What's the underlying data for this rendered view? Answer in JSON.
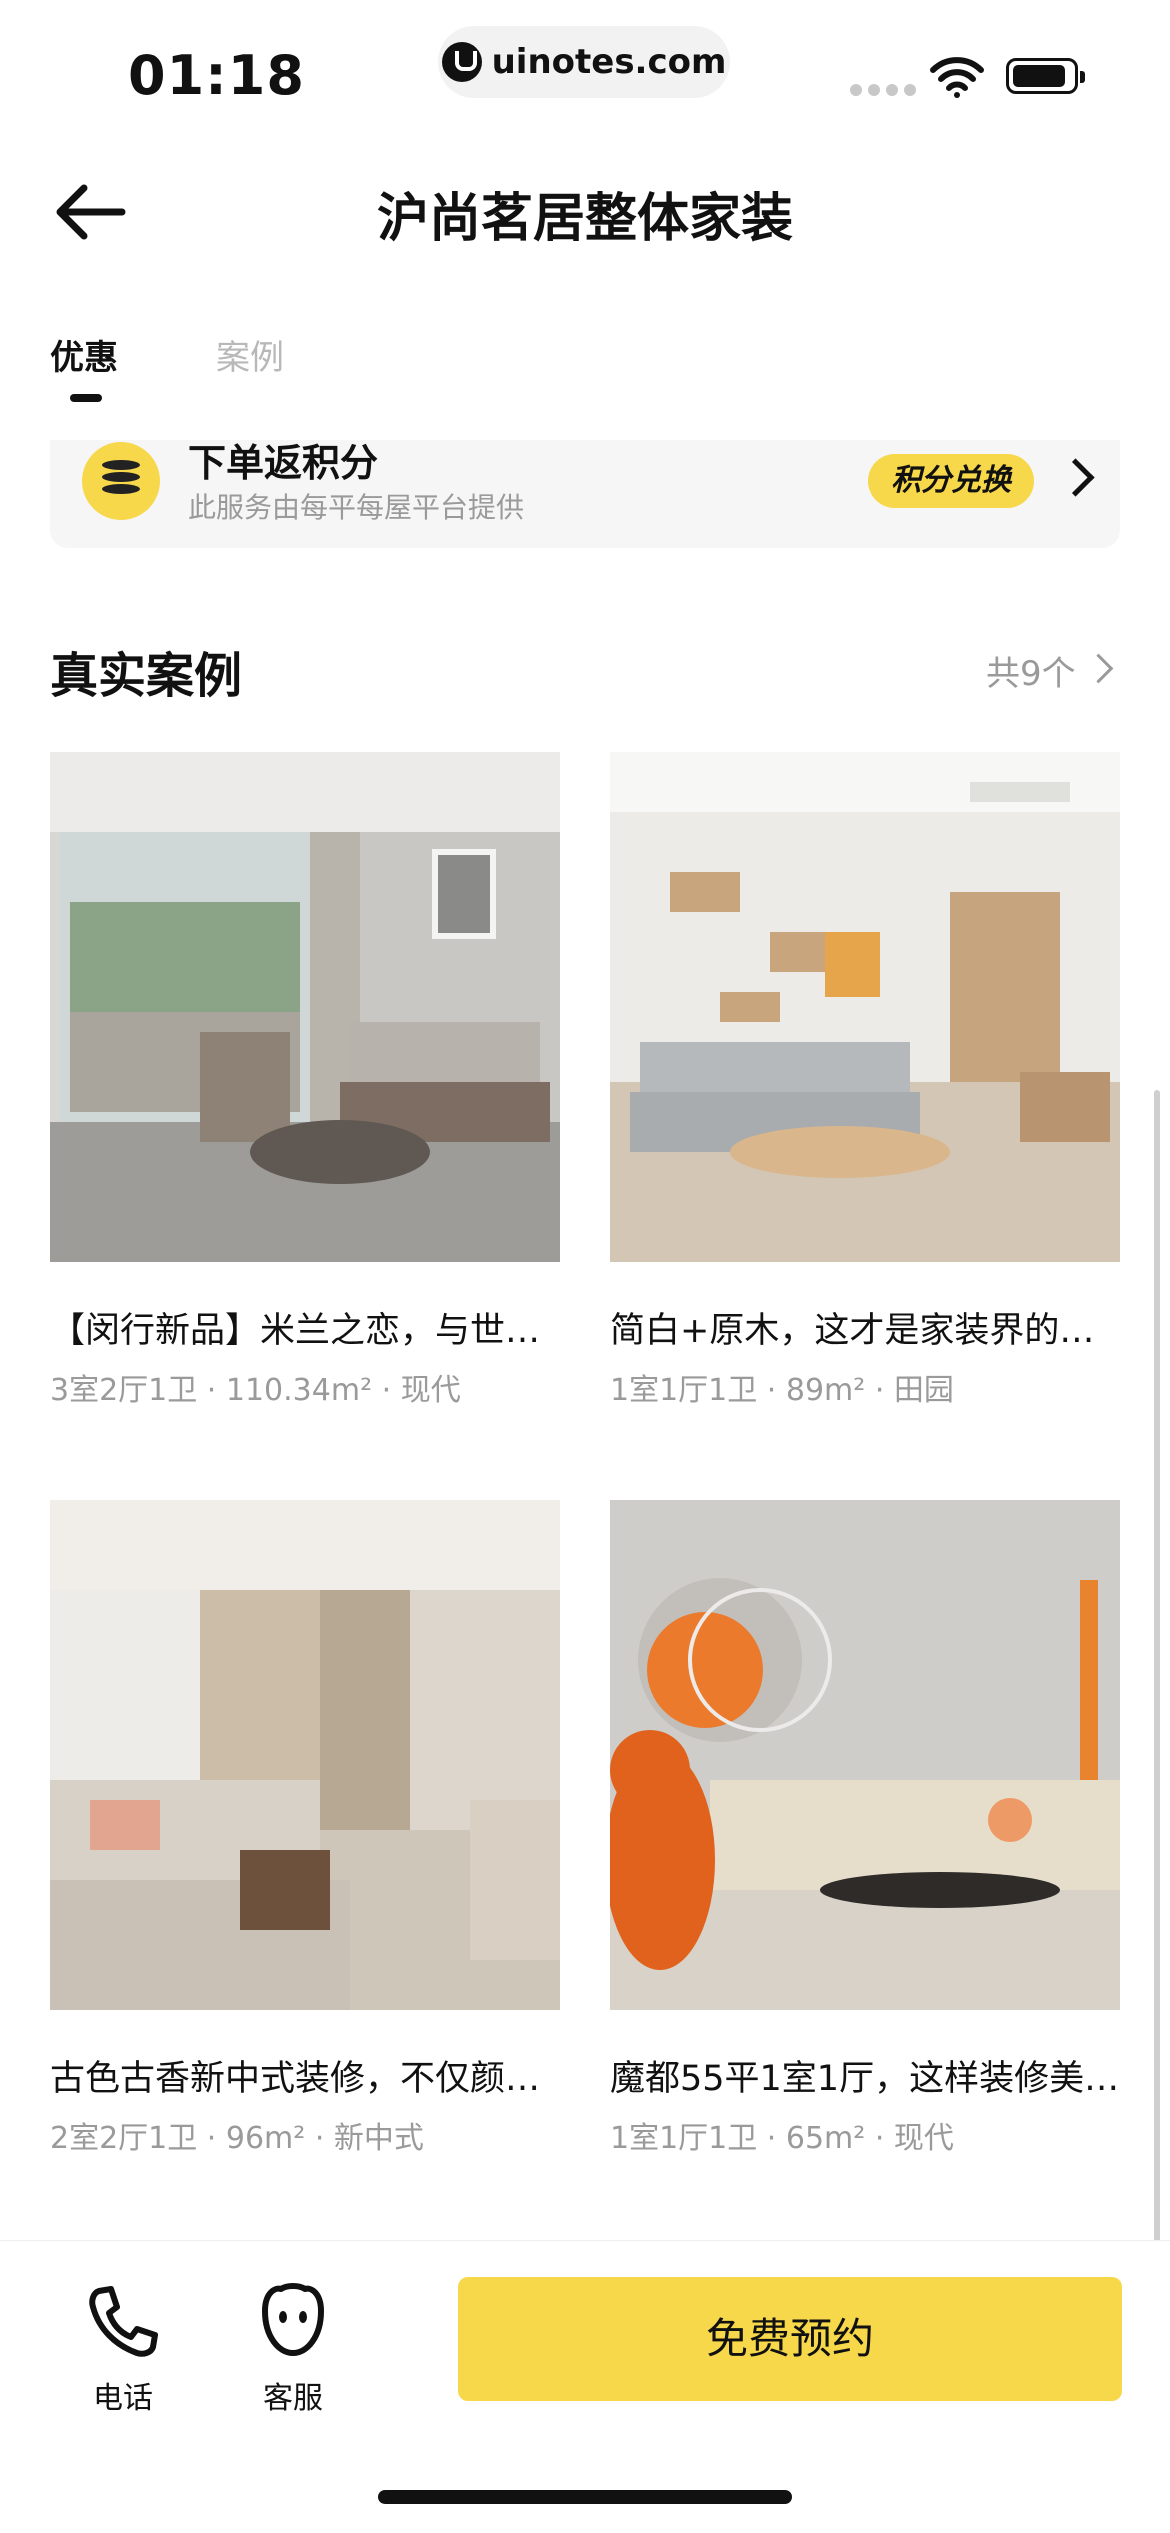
{
  "status_bar": {
    "time": "01:18",
    "url": "uinotes.com"
  },
  "nav": {
    "title": "沪尚茗居整体家装"
  },
  "tabs": [
    {
      "label": "优惠",
      "active": true
    },
    {
      "label": "案例",
      "active": false
    }
  ],
  "points_card": {
    "title": "下单返积分",
    "subtitle": "此服务由每平每屋平台提供",
    "badge": "积分兑换"
  },
  "section": {
    "title": "真实案例",
    "count_label": "共9个"
  },
  "cases": [
    {
      "title": "【闵行新品】米兰之恋，与世…",
      "meta": "3室2厅1卫 · 110.34m² · 现代"
    },
    {
      "title": "简白+原木，这才是家装界的…",
      "meta": "1室1厅1卫 · 89m² · 田园"
    },
    {
      "title": "古色古香新中式装修，不仅颜…",
      "meta": "2室2厅1卫 · 96m² · 新中式"
    },
    {
      "title": "魔都55平1室1厅，这样装修美…",
      "meta": "1室1厅1卫 · 65m² · 现代"
    }
  ],
  "bottom_bar": {
    "phone_label": "电话",
    "service_label": "客服",
    "book_label": "免费预约"
  },
  "colors": {
    "accent": "#f6d84a",
    "text": "#111111",
    "muted": "#9a9a9a"
  }
}
